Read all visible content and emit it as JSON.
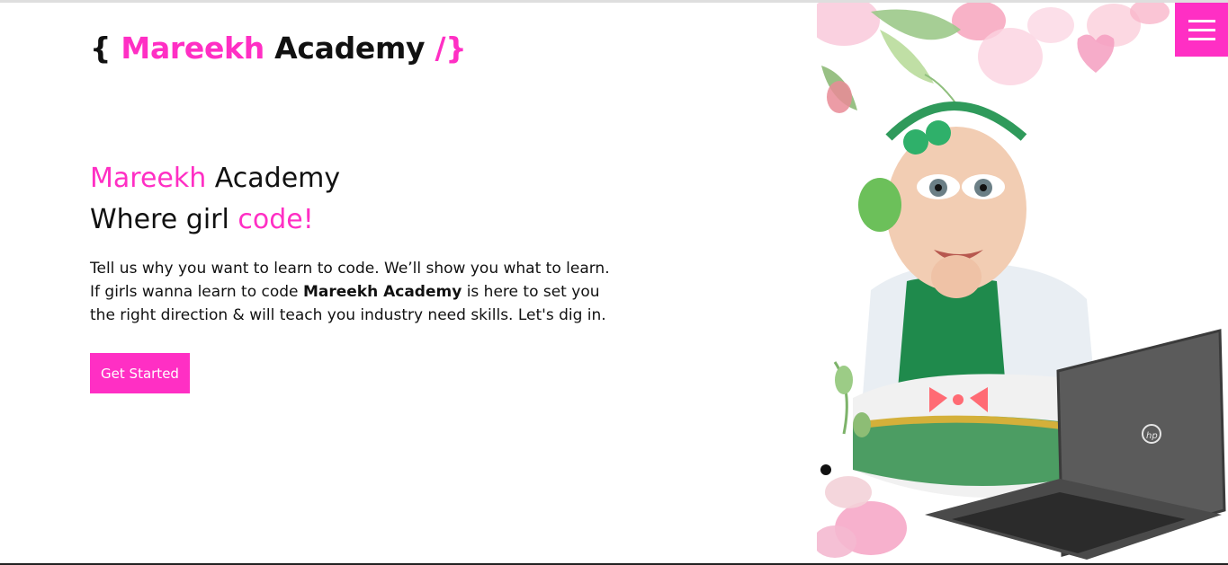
{
  "logo": {
    "open_brace": "{",
    "word1": "Mareekh",
    "word2": "Academy",
    "close_slash": "/",
    "close_brace": "}"
  },
  "hero": {
    "line1_pink": "Mareekh",
    "line1_dark": "Academy",
    "line2_dark": "Where girl",
    "line2_pink": "code!",
    "desc_line1": "Tell us why you want to learn to code. We’ll show you what to learn.",
    "desc_line2_pre": "If girls wanna learn to code",
    "desc_line2_bold": "Mareekh Academy",
    "desc_line2_post": "is here to set you",
    "desc_line3": "the right direction & will teach you industry need skills. Let's dig in.",
    "cta_label": "Get Started"
  },
  "colors": {
    "accent": "#ff2fc4",
    "text": "#111111",
    "background": "#ffffff"
  },
  "icons": {
    "menu": "hamburger-menu-icon",
    "laptop_logo": "hp"
  }
}
